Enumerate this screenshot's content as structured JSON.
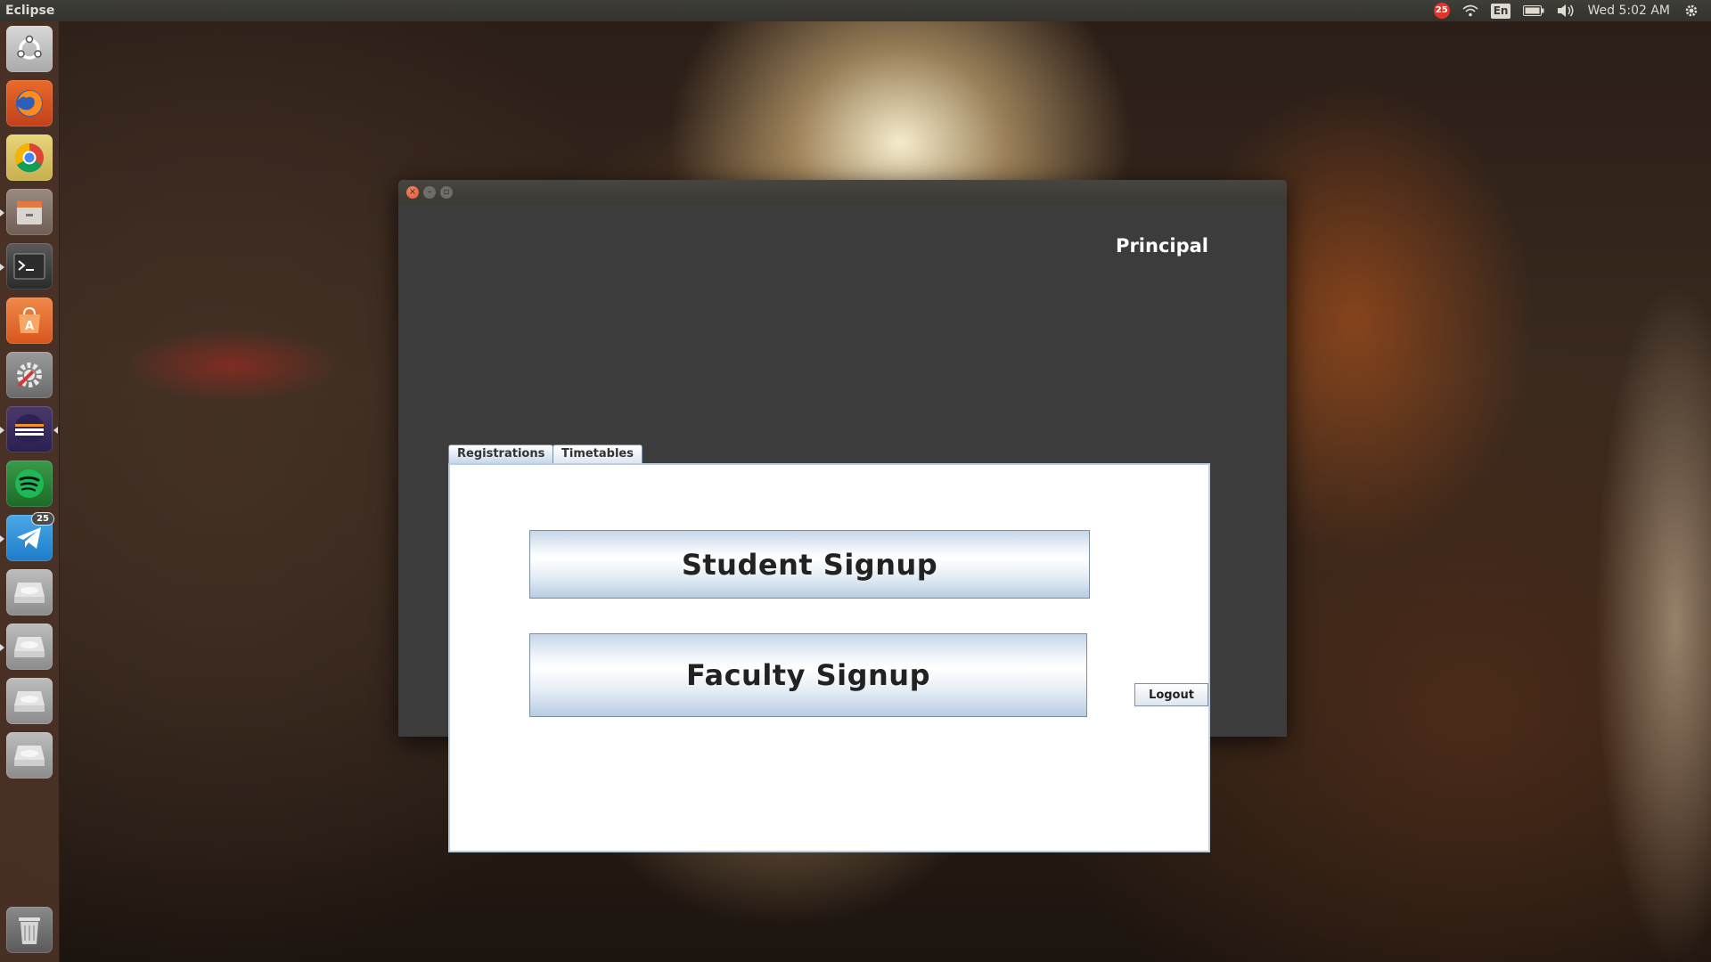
{
  "top_panel": {
    "app_name": "Eclipse",
    "notification_count": "25",
    "keyboard_layout": "En",
    "clock": "Wed 5:02 AM"
  },
  "launcher": {
    "items": [
      {
        "name": "Ubuntu Dash",
        "icon": "ubuntu-logo-icon"
      },
      {
        "name": "Firefox",
        "icon": "firefox-icon"
      },
      {
        "name": "Chromium",
        "icon": "chrome-icon"
      },
      {
        "name": "Files",
        "icon": "files-icon"
      },
      {
        "name": "Terminal",
        "icon": "terminal-icon"
      },
      {
        "name": "Ubuntu Software",
        "icon": "software-center-icon"
      },
      {
        "name": "System Settings",
        "icon": "settings-icon"
      },
      {
        "name": "Eclipse",
        "icon": "eclipse-icon"
      },
      {
        "name": "Spotify",
        "icon": "spotify-icon"
      },
      {
        "name": "Telegram",
        "icon": "telegram-icon",
        "badge": "25"
      },
      {
        "name": "Drive 1",
        "icon": "drive-icon"
      },
      {
        "name": "Drive 2",
        "icon": "drive-icon"
      },
      {
        "name": "Drive 3",
        "icon": "drive-icon"
      },
      {
        "name": "Drive 4",
        "icon": "drive-icon"
      },
      {
        "name": "Trash",
        "icon": "trash-icon"
      }
    ]
  },
  "window": {
    "role_label": "Principal",
    "tabs": [
      {
        "label": "Registrations",
        "active": true
      },
      {
        "label": "Timetables",
        "active": false
      }
    ],
    "buttons": {
      "student_signup": "Student Signup",
      "faculty_signup": "Faculty Signup",
      "logout": "Logout"
    }
  },
  "colors": {
    "panel_border": "#b8cfe6",
    "button_border": "#7a8ea5",
    "window_bg": "#3c3c3c",
    "close_button": "#e0552e"
  }
}
